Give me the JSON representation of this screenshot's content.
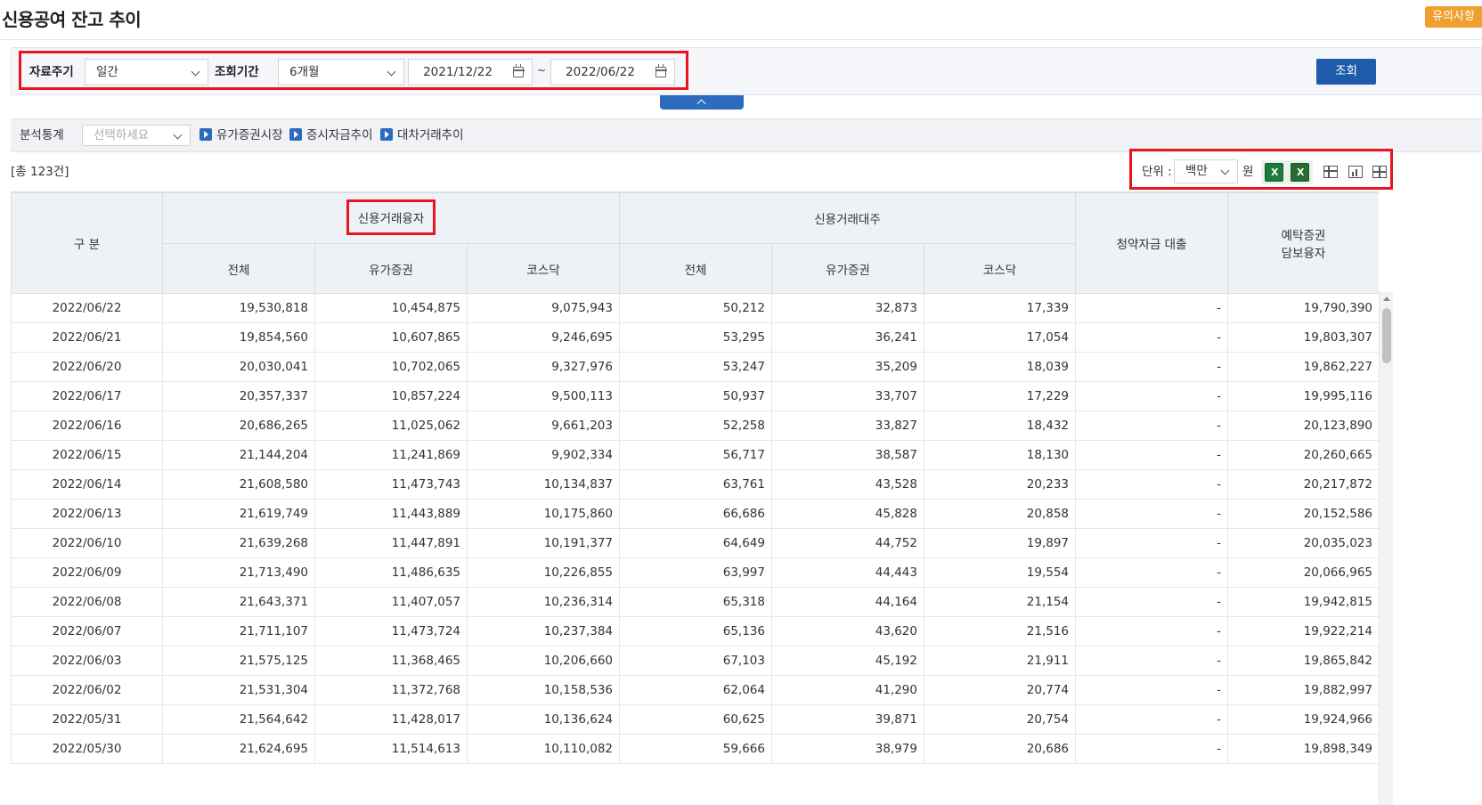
{
  "page": {
    "title": "신용공여 잔고 추이",
    "notice_button": "유의사항"
  },
  "filters": {
    "period_label": "자료주기",
    "period_value": "일간",
    "range_label": "조회기간",
    "range_value": "6개월",
    "start_date": "2021/12/22",
    "tilde": "~",
    "end_date": "2022/06/22",
    "search_button": "조회"
  },
  "analysis": {
    "label": "분석통계",
    "select_placeholder": "선택하세요",
    "links": [
      "유가증권시장",
      "증시자금추이",
      "대차거래추이"
    ]
  },
  "summary": {
    "total": "[총 123건]"
  },
  "unit": {
    "label": "단위 :",
    "value": "백만",
    "suffix": "원"
  },
  "colors": {
    "accent": "#1e5bab",
    "highlight": "#e8141f",
    "notice": "#f0a030"
  },
  "table": {
    "headers": {
      "category": "구 분",
      "group_loan": "신용거래융자",
      "group_short": "신용거래대주",
      "subscription": "청약자금 대출",
      "deposit_line1": "예탁증권",
      "deposit_line2": "담보융자",
      "sub": [
        "전체",
        "유가증권",
        "코스닥",
        "전체",
        "유가증권",
        "코스닥"
      ]
    },
    "rows": [
      [
        "2022/06/22",
        "19,530,818",
        "10,454,875",
        "9,075,943",
        "50,212",
        "32,873",
        "17,339",
        "-",
        "19,790,390"
      ],
      [
        "2022/06/21",
        "19,854,560",
        "10,607,865",
        "9,246,695",
        "53,295",
        "36,241",
        "17,054",
        "-",
        "19,803,307"
      ],
      [
        "2022/06/20",
        "20,030,041",
        "10,702,065",
        "9,327,976",
        "53,247",
        "35,209",
        "18,039",
        "-",
        "19,862,227"
      ],
      [
        "2022/06/17",
        "20,357,337",
        "10,857,224",
        "9,500,113",
        "50,937",
        "33,707",
        "17,229",
        "-",
        "19,995,116"
      ],
      [
        "2022/06/16",
        "20,686,265",
        "11,025,062",
        "9,661,203",
        "52,258",
        "33,827",
        "18,432",
        "-",
        "20,123,890"
      ],
      [
        "2022/06/15",
        "21,144,204",
        "11,241,869",
        "9,902,334",
        "56,717",
        "38,587",
        "18,130",
        "-",
        "20,260,665"
      ],
      [
        "2022/06/14",
        "21,608,580",
        "11,473,743",
        "10,134,837",
        "63,761",
        "43,528",
        "20,233",
        "-",
        "20,217,872"
      ],
      [
        "2022/06/13",
        "21,619,749",
        "11,443,889",
        "10,175,860",
        "66,686",
        "45,828",
        "20,858",
        "-",
        "20,152,586"
      ],
      [
        "2022/06/10",
        "21,639,268",
        "11,447,891",
        "10,191,377",
        "64,649",
        "44,752",
        "19,897",
        "-",
        "20,035,023"
      ],
      [
        "2022/06/09",
        "21,713,490",
        "11,486,635",
        "10,226,855",
        "63,997",
        "44,443",
        "19,554",
        "-",
        "20,066,965"
      ],
      [
        "2022/06/08",
        "21,643,371",
        "11,407,057",
        "10,236,314",
        "65,318",
        "44,164",
        "21,154",
        "-",
        "19,942,815"
      ],
      [
        "2022/06/07",
        "21,711,107",
        "11,473,724",
        "10,237,384",
        "65,136",
        "43,620",
        "21,516",
        "-",
        "19,922,214"
      ],
      [
        "2022/06/03",
        "21,575,125",
        "11,368,465",
        "10,206,660",
        "67,103",
        "45,192",
        "21,911",
        "-",
        "19,865,842"
      ],
      [
        "2022/06/02",
        "21,531,304",
        "11,372,768",
        "10,158,536",
        "62,064",
        "41,290",
        "20,774",
        "-",
        "19,882,997"
      ],
      [
        "2022/05/31",
        "21,564,642",
        "11,428,017",
        "10,136,624",
        "60,625",
        "39,871",
        "20,754",
        "-",
        "19,924,966"
      ],
      [
        "2022/05/30",
        "21,624,695",
        "11,514,613",
        "10,110,082",
        "59,666",
        "38,979",
        "20,686",
        "-",
        "19,898,349"
      ]
    ]
  },
  "icons": [
    "chevron-down-icon",
    "calendar-icon",
    "chevron-up-icon",
    "play-icon",
    "excel-icon",
    "table-view-icon",
    "chart-view-icon",
    "grid-view-icon"
  ]
}
